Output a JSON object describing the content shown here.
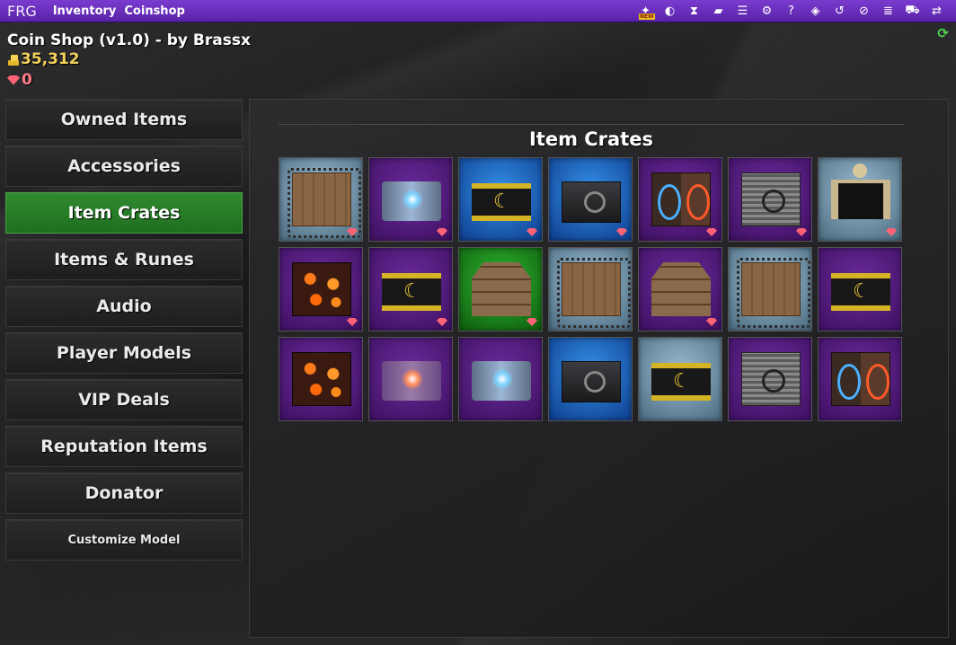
{
  "topbar": {
    "brand": "FRG",
    "links": [
      "Inventory",
      "Coinshop"
    ],
    "icons": [
      "new-icon",
      "contrast-icon",
      "hourglass-icon",
      "note-icon",
      "list-icon",
      "gears-icon",
      "help-icon",
      "cube-icon",
      "undo-icon",
      "compass-icon",
      "checklist-icon",
      "cart-icon",
      "swap-icon"
    ],
    "new_badge": "NEW",
    "accent": "#6a2fbf"
  },
  "header": {
    "title": "Coin Shop (v1.0) - by Brassx",
    "coins": "35,312",
    "gems": "0"
  },
  "sidebar": {
    "items": [
      {
        "label": "Owned Items"
      },
      {
        "label": "Accessories"
      },
      {
        "label": "Item Crates",
        "active": true
      },
      {
        "label": "Items & Runes"
      },
      {
        "label": "Audio"
      },
      {
        "label": "Player Models"
      },
      {
        "label": "VIP Deals"
      },
      {
        "label": "Reputation Items"
      },
      {
        "label": "Donator"
      },
      {
        "label": "Customize Model"
      }
    ],
    "active_color": "#2a832a"
  },
  "panel": {
    "title": "Item Crates",
    "tiles": [
      {
        "icon": "chained-wooden-crate",
        "bg": "light",
        "gem": true
      },
      {
        "icon": "glowing-blue-chest",
        "bg": "purple",
        "gem": true
      },
      {
        "icon": "moon-gold-chest",
        "bg": "blue",
        "gem": true
      },
      {
        "icon": "dark-metal-chest",
        "bg": "blue",
        "gem": true
      },
      {
        "icon": "rune-portal-crate",
        "bg": "purple",
        "gem": true
      },
      {
        "icon": "stone-crate",
        "bg": "purple",
        "gem": true
      },
      {
        "icon": "bone-chest",
        "bg": "light",
        "gem": true
      },
      {
        "icon": "fire-crate",
        "bg": "purple",
        "gem": true
      },
      {
        "icon": "moon-gold-chest",
        "bg": "purple",
        "gem": true
      },
      {
        "icon": "stacked-crates",
        "bg": "green",
        "gem": true
      },
      {
        "icon": "chained-wooden-crate",
        "bg": "light",
        "gem": false
      },
      {
        "icon": "stacked-crates",
        "bg": "purple",
        "gem": true
      },
      {
        "icon": "chained-wooden-crate",
        "bg": "light",
        "gem": false
      },
      {
        "icon": "moon-gold-chest",
        "bg": "purple",
        "gem": false
      },
      {
        "icon": "fire-crate",
        "bg": "purple",
        "gem": false
      },
      {
        "icon": "glowing-orange-chest",
        "bg": "purple",
        "gem": false
      },
      {
        "icon": "glowing-blue-chest",
        "bg": "purple",
        "gem": false
      },
      {
        "icon": "dark-metal-chest",
        "bg": "blue",
        "gem": false
      },
      {
        "icon": "moon-gold-chest",
        "bg": "light",
        "gem": false
      },
      {
        "icon": "stone-crate",
        "bg": "purple",
        "gem": false
      },
      {
        "icon": "rune-portal-crate",
        "bg": "purple",
        "gem": false
      }
    ]
  }
}
